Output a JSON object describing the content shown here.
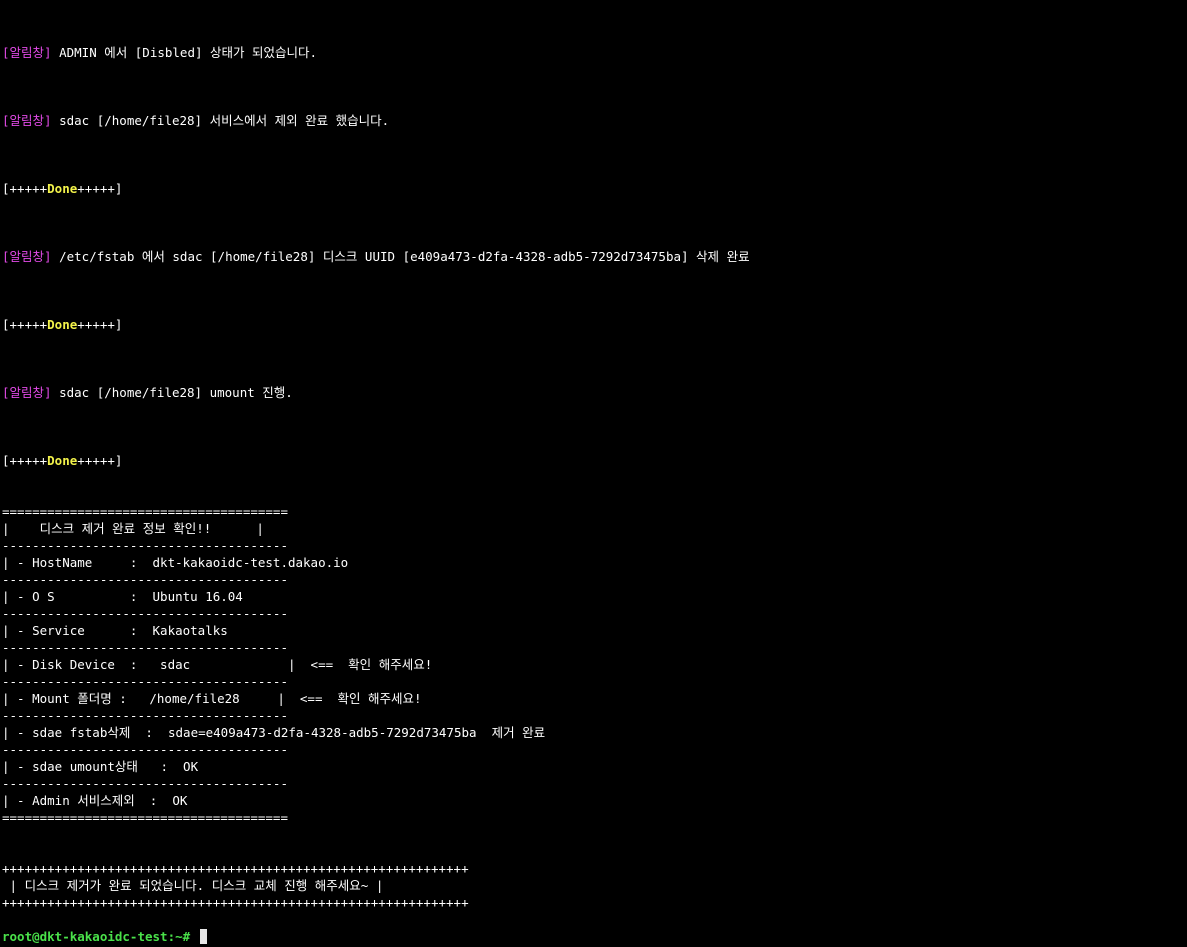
{
  "colors": {
    "background": "#000000",
    "text": "#ffffff",
    "tag": "#e14ae6",
    "done": "#f2f24a",
    "prompt": "#4ae14a"
  },
  "log": {
    "tag": "[알림창]",
    "l1_text": " ADMIN 에서 [Disbled] 상태가 되었습니다.",
    "l2_text": " sdac [/home/file28] 서비스에서 제외 완료 했습니다.",
    "l4_text": " /etc/fstab 에서 sdac [/home/file28] 디스크 UUID [e409a473-d2fa-4328-adb5-7292d73475ba] 삭제 완료",
    "l6_text": " sdac [/home/file28] umount 진행.",
    "done_pre": "[+++++",
    "done_word": "Done",
    "done_post": "+++++]"
  },
  "summary": {
    "border_double": "======================================",
    "border_single": "--------------------------------------",
    "title_row": "|    디스크 제거 완료 정보 확인!!      |",
    "rows": [
      "| - HostName     :  dkt-kakaoidc-test.dakao.io",
      "| - O S          :  Ubuntu 16.04",
      "| - Service      :  Kakaotalks",
      "| - Disk Device  :   sdac             |  <==  확인 해주세요!",
      "| - Mount 폴더명 :   /home/file28     |  <==  확인 해주세요!",
      "| - sdae fstab삭제  :  sdae=e409a473-d2fa-4328-adb5-7292d73475ba  제거 완료",
      "| - sdae umount상태   :  OK",
      "| - Admin 서비스제외  :  OK"
    ]
  },
  "final": {
    "border": "++++++++++++++++++++++++++++++++++++++++++++++++++++++++++++++",
    "message": " | 디스크 제거가 완료 되었습니다. 디스크 교체 진행 해주세요~ |"
  },
  "prompt": {
    "text": "root@dkt-kakaoidc-test:~#"
  }
}
